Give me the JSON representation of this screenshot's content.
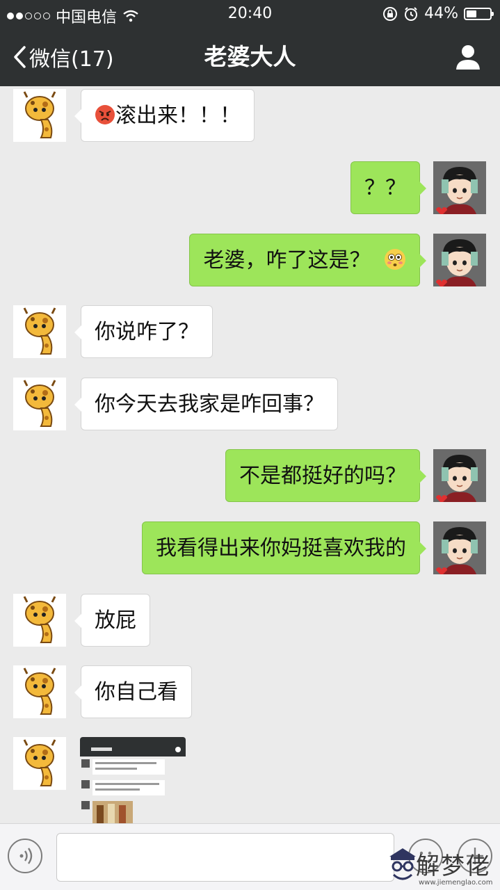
{
  "status_bar": {
    "carrier": "中国电信",
    "time": "20:40",
    "battery": "44%",
    "battery_level": 0.44,
    "signal_bars": 2
  },
  "nav": {
    "back_label": "微信(17)",
    "title": "老婆大人"
  },
  "messages": [
    {
      "side": "left",
      "text": "滚出来！！！",
      "emoji": "angry-face-emoji"
    },
    {
      "side": "right",
      "text": "？？"
    },
    {
      "side": "right",
      "text": "老婆，咋了这是？",
      "emoji": "flushed-face-emoji"
    },
    {
      "side": "left",
      "text": "你说咋了？"
    },
    {
      "side": "left",
      "text": "你今天去我家是咋回事？"
    },
    {
      "side": "right",
      "text": "不是都挺好的吗？"
    },
    {
      "side": "right",
      "text": "我看得出来你妈挺喜欢我的"
    },
    {
      "side": "left",
      "text": "放屁"
    },
    {
      "side": "left",
      "text": "你自己看"
    },
    {
      "side": "left",
      "type": "image"
    }
  ],
  "watermark": {
    "text": "解梦佬",
    "url": "www.jiemenglao.com"
  },
  "colors": {
    "nav_bg": "#2e3132",
    "chat_bg": "#ebebeb",
    "sent_bubble": "#9de55a",
    "received_bubble": "#ffffff"
  }
}
